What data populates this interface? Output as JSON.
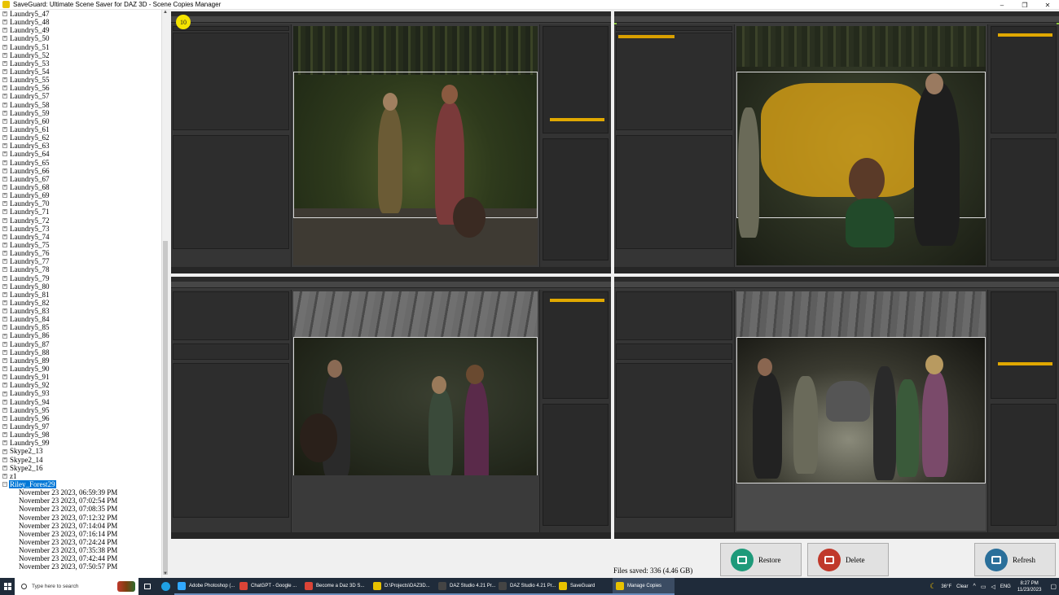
{
  "window": {
    "title": "SaveGuard: Ultimate Scene Saver for DAZ 3D - Scene Copies Manager"
  },
  "window_controls": {
    "minimize": "–",
    "maximize": "❐",
    "close": "✕"
  },
  "tree": {
    "items": [
      "Laundry5_47",
      "Laundry5_48",
      "Laundry5_49",
      "Laundry5_50",
      "Laundry5_51",
      "Laundry5_52",
      "Laundry5_53",
      "Laundry5_54",
      "Laundry5_55",
      "Laundry5_56",
      "Laundry5_57",
      "Laundry5_58",
      "Laundry5_59",
      "Laundry5_60",
      "Laundry5_61",
      "Laundry5_62",
      "Laundry5_63",
      "Laundry5_64",
      "Laundry5_65",
      "Laundry5_66",
      "Laundry5_67",
      "Laundry5_68",
      "Laundry5_69",
      "Laundry5_70",
      "Laundry5_71",
      "Laundry5_72",
      "Laundry5_73",
      "Laundry5_74",
      "Laundry5_75",
      "Laundry5_76",
      "Laundry5_77",
      "Laundry5_78",
      "Laundry5_79",
      "Laundry5_80",
      "Laundry5_81",
      "Laundry5_82",
      "Laundry5_83",
      "Laundry5_84",
      "Laundry5_85",
      "Laundry5_86",
      "Laundry5_87",
      "Laundry5_88",
      "Laundry5_89",
      "Laundry5_90",
      "Laundry5_91",
      "Laundry5_92",
      "Laundry5_93",
      "Laundry5_94",
      "Laundry5_95",
      "Laundry5_96",
      "Laundry5_97",
      "Laundry5_98",
      "Laundry5_99",
      "Skype2_13",
      "Skype2_14",
      "Skype2_16",
      "z1"
    ],
    "expanded_item": "Riley_Forest29",
    "expanded_children": [
      "November 23 2023, 06:59:39 PM",
      "November 23 2023, 07:02:54 PM",
      "November 23 2023, 07:08:35 PM",
      "November 23 2023, 07:12:32 PM",
      "November 23 2023, 07:14:04 PM",
      "November 23 2023, 07:16:14 PM",
      "November 23 2023, 07:24:24 PM",
      "November 23 2023, 07:35:38 PM",
      "November 23 2023, 07:42:44 PM",
      "November 23 2023, 07:50:57 PM"
    ],
    "expander_collapsed": "+",
    "expander_expanded": "−"
  },
  "previews": {
    "badge": "10",
    "count": 4,
    "selected_index": 1
  },
  "bottom": {
    "files_saved": "Files saved: 336 (4.46 GB)",
    "restore_label": "Restore",
    "delete_label": "Delete",
    "refresh_label": "Refresh"
  },
  "colors": {
    "restore_icon": "#1e9a7a",
    "delete_icon": "#c0392b",
    "refresh_icon": "#2a6f9a",
    "selection_outline": "#8cc63f",
    "tree_selection": "#0078d7",
    "badge": "#f5e400"
  },
  "taskbar": {
    "search_placeholder": "Type here to search",
    "tasks": [
      {
        "label": "Adobe Photoshop (...",
        "icon_color": "#31a8ff"
      },
      {
        "label": "ChatGPT - Google ...",
        "icon_color": "#db4437"
      },
      {
        "label": "Become a Daz 3D S...",
        "icon_color": "#db4437"
      },
      {
        "label": "D:\\Projects\\DAZ3D...",
        "icon_color": "#e8c200"
      },
      {
        "label": "DAZ Studio 4.21 Pr...",
        "icon_color": "#444"
      },
      {
        "label": "DAZ Studio 4.21 Pr...",
        "icon_color": "#444"
      },
      {
        "label": "SaveGuard",
        "icon_color": "#e8c200"
      },
      {
        "label": "Manage Copies",
        "icon_color": "#e8c200"
      }
    ],
    "weather_temp": "36°F",
    "weather_desc": "Clear",
    "language": "ENG",
    "time": "8:27 PM",
    "date": "11/23/2023"
  }
}
